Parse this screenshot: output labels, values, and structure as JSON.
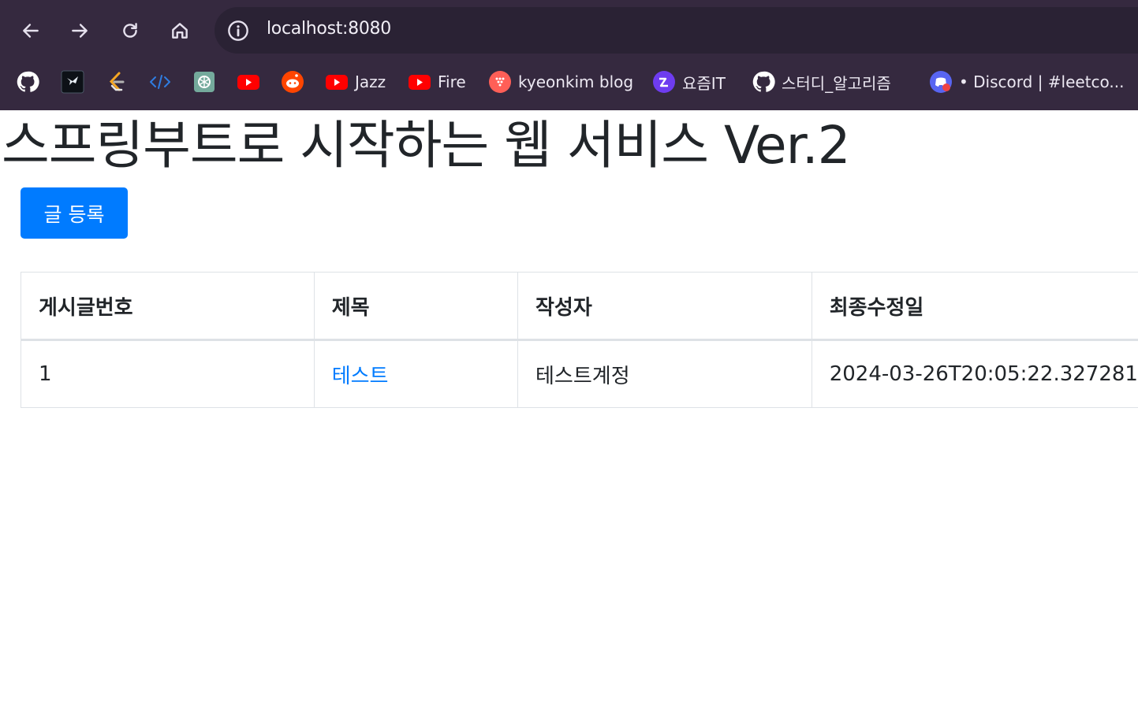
{
  "browser": {
    "url": "localhost:8080",
    "bookmarks": [
      {
        "icon": "github-icon",
        "label": ""
      },
      {
        "icon": "bird-app-icon",
        "label": ""
      },
      {
        "icon": "leetcode-icon",
        "label": ""
      },
      {
        "icon": "code-brackets-icon",
        "label": ""
      },
      {
        "icon": "chatgpt-icon",
        "label": ""
      },
      {
        "icon": "youtube-icon",
        "label": ""
      },
      {
        "icon": "reddit-icon",
        "label": ""
      },
      {
        "icon": "youtube-icon",
        "label": "Jazz"
      },
      {
        "icon": "youtube-icon",
        "label": "Fire"
      },
      {
        "icon": "blog-icon",
        "label": "kyeonkim blog"
      },
      {
        "icon": "yozm-icon",
        "label": "요즘IT"
      },
      {
        "icon": "github-icon",
        "label": "스터디_알고리즘"
      },
      {
        "icon": "discord-icon",
        "label": "• Discord | #leetco..."
      }
    ]
  },
  "page": {
    "title": "스프링부트로 시작하는 웹 서비스 Ver.2",
    "write_button": "글 등록",
    "table": {
      "headers": [
        "게시글번호",
        "제목",
        "작성자",
        "최종수정일"
      ],
      "rows": [
        {
          "id": "1",
          "title": "테스트",
          "author": "테스트계정",
          "modified": "2024-03-26T20:05:22.327281"
        }
      ]
    }
  },
  "colors": {
    "chrome_bg": "#35293f",
    "urlbar_bg": "#2a2234",
    "primary": "#007bff",
    "text": "#212529",
    "border": "#dee2e6"
  }
}
